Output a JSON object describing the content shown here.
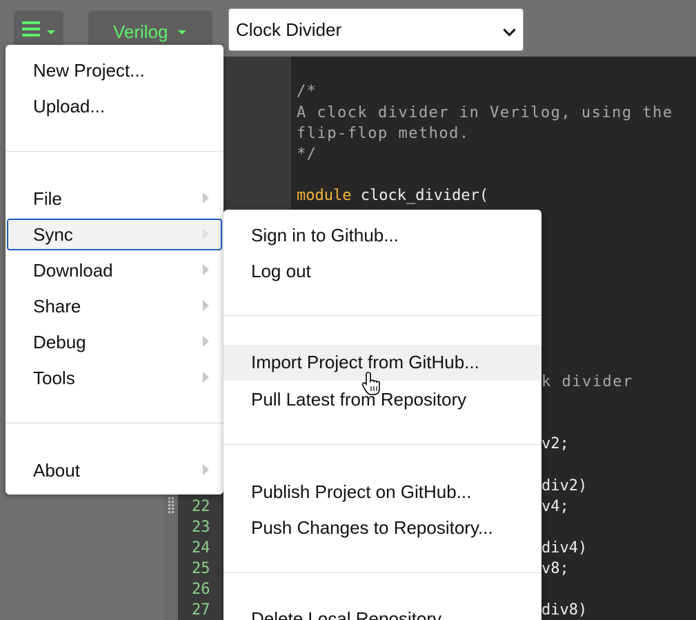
{
  "toolbar": {
    "menu_icon": "hamburger-icon",
    "language_label": "Verilog",
    "project_select_value": "Clock Divider",
    "accent_color": "#5ef06a"
  },
  "editor": {
    "comment_lines": [
      "/*",
      "A clock divider in Verilog, using the",
      "flip-flop method.",
      "*/"
    ],
    "module_keyword": "module",
    "module_rest": " clock_divider(",
    "line_numbers": [
      "22",
      "23",
      "24",
      "25",
      "26",
      "27"
    ],
    "visible_fragments": [
      "k divider",
      "v2;",
      "div2)",
      "v4;",
      "div4)",
      "v8;",
      "div8)"
    ]
  },
  "main_menu": {
    "items_top": [
      "New Project...",
      "Upload..."
    ],
    "items_mid": [
      "File",
      "Sync",
      "Download",
      "Share",
      "Debug",
      "Tools"
    ],
    "items_bottom": [
      "About"
    ],
    "active_item": "Sync"
  },
  "sync_menu": {
    "items": [
      "Sign in to Github...",
      "Log out",
      "Import Project from GitHub...",
      "Pull Latest from Repository",
      "Publish Project on GitHub...",
      "Push Changes to Repository...",
      "Delete Local Repository..."
    ],
    "hovered_item": "Import Project from GitHub..."
  }
}
